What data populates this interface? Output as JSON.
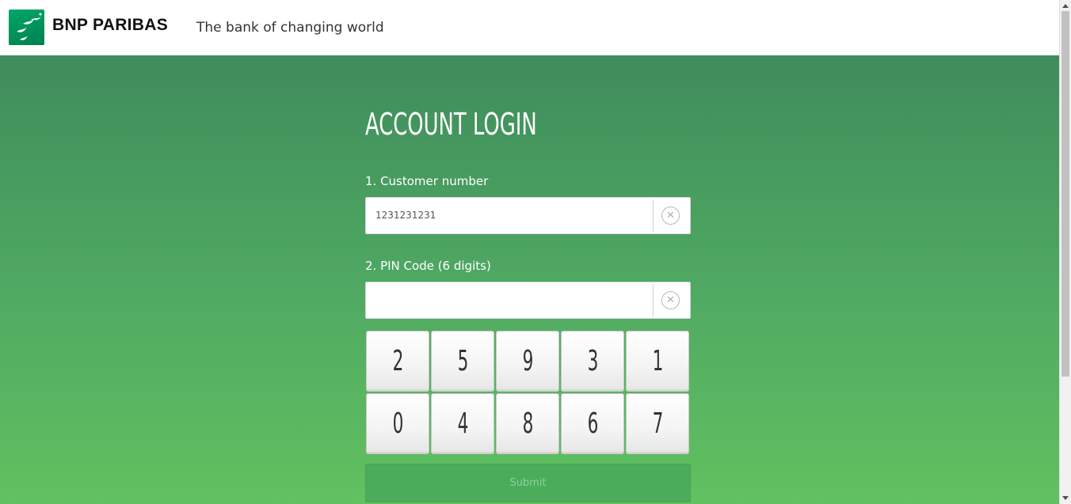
{
  "header": {
    "brand_name": "BNP PARIBAS",
    "tagline": "The bank of changing world",
    "logo_icon": "bnp-stars-logo-icon"
  },
  "login": {
    "title": "ACCOUNT LOGIN",
    "customer_label": "1. Customer number",
    "customer_value": "1231231231",
    "pin_label": "2. PIN Code (6 digits)",
    "pin_value": "",
    "clear_icon": "close-circle-icon",
    "keypad": [
      "2",
      "5",
      "9",
      "3",
      "1",
      "0",
      "4",
      "8",
      "6",
      "7"
    ],
    "submit_label": "Submit"
  },
  "colors": {
    "brand_green": "#00965e",
    "gradient_top": "#3f8c5c",
    "gradient_bottom": "#62c160"
  }
}
